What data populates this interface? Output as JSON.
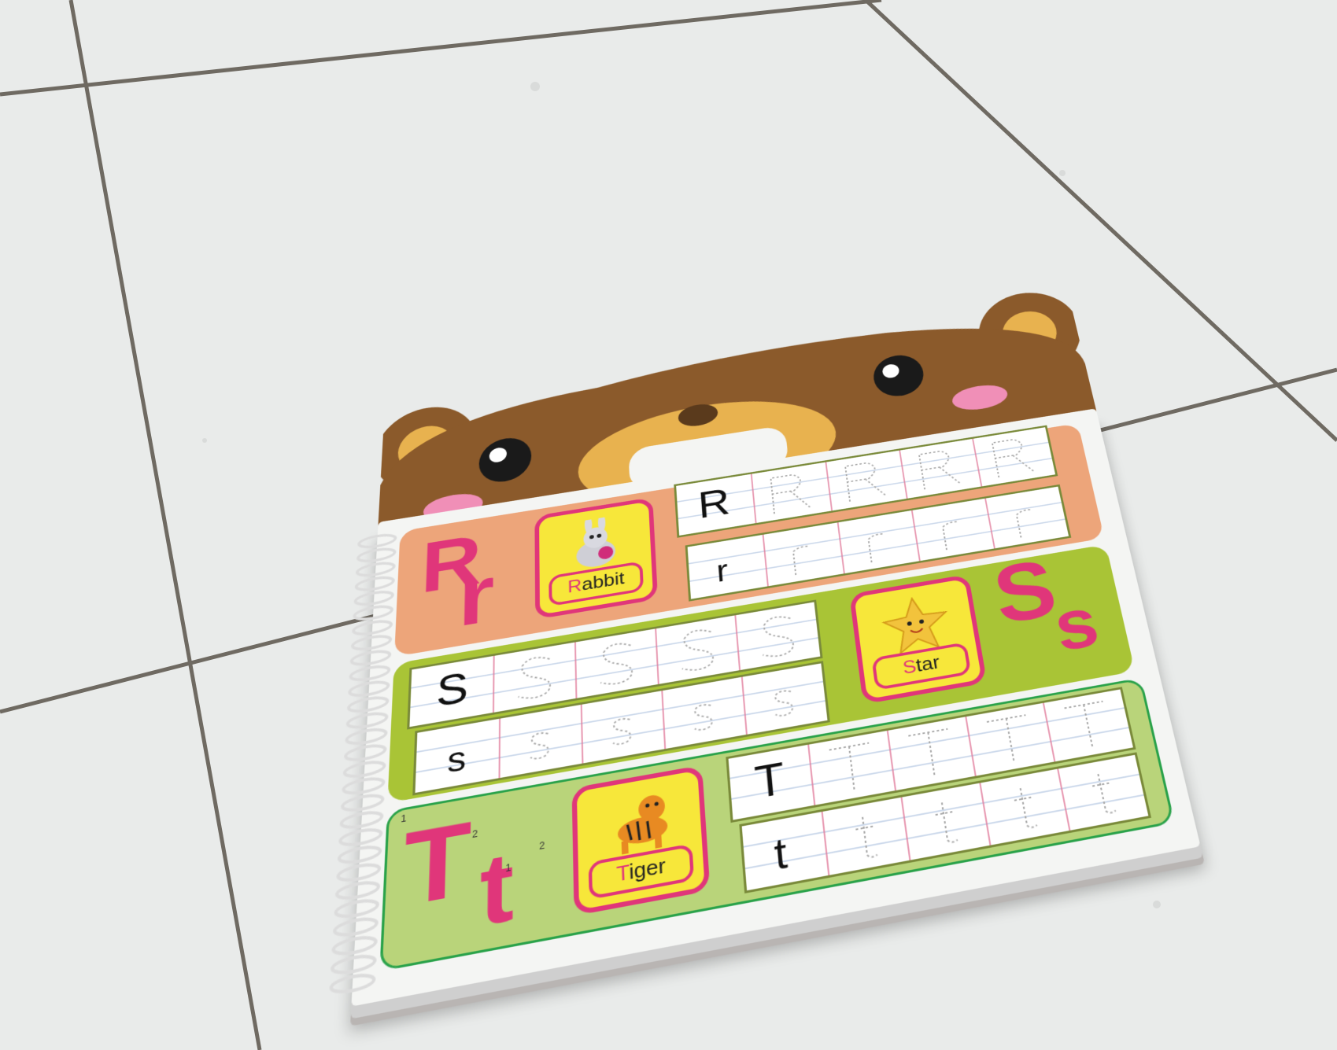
{
  "colors": {
    "floor": "#e9ebea",
    "grout": "#6f6a62",
    "bear_brown": "#8b5a2b",
    "bear_tan": "#e8b24f",
    "cheek_pink": "#f08fb7",
    "letter_pink": "#e0367a",
    "panel_r": "#eda57a",
    "panel_s": "#a9c436",
    "panel_t": "#b9d47a",
    "card_yellow": "#f7e73a"
  },
  "sections": [
    {
      "id": "r",
      "upper": "R",
      "lower": "r",
      "word": "Rabbit",
      "word_initial": "R",
      "word_rest": "abbit",
      "picture_icon": "rabbit-icon"
    },
    {
      "id": "s",
      "upper": "S",
      "lower": "s",
      "word": "Star",
      "word_initial": "S",
      "word_rest": "tar",
      "picture_icon": "star-icon"
    },
    {
      "id": "t",
      "upper": "T",
      "lower": "t",
      "word": "Tiger",
      "word_initial": "T",
      "word_rest": "iger",
      "picture_icon": "tiger-icon"
    }
  ],
  "stroke_numbers": [
    "1",
    "2",
    "1",
    "2"
  ]
}
